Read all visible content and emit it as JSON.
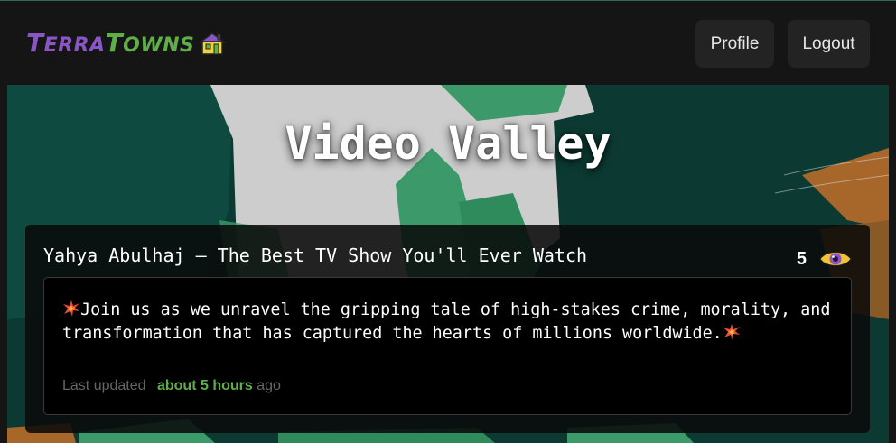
{
  "header": {
    "logo": {
      "part1_initial": "T",
      "part1_rest": "ERRA",
      "part2_initial": "T",
      "part2_rest": "OWNS"
    },
    "nav": {
      "profile_label": "Profile",
      "logout_label": "Logout"
    }
  },
  "town": {
    "name": "Video Valley"
  },
  "home": {
    "title": "Yahya Abulhaj — The Best TV Show You'll Ever Watch",
    "visit_count": "5",
    "description_text": "Join us as we unravel the gripping tale of high-stakes crime, morality, and transformation that has captured the hearts of millions worldwide.",
    "last_updated_label": "Last updated",
    "last_updated_value": "about 5 hours",
    "last_updated_suffix": "ago"
  },
  "colors": {
    "logo_purple": "#8a55c4",
    "logo_green": "#5fae4a",
    "nav_button_bg": "#232323",
    "panel_bg": "#0a0a0a",
    "updated_accent": "#5fae4a"
  },
  "icons": [
    "house-logo-icon",
    "eye-icon",
    "collision-emoji-icon"
  ]
}
